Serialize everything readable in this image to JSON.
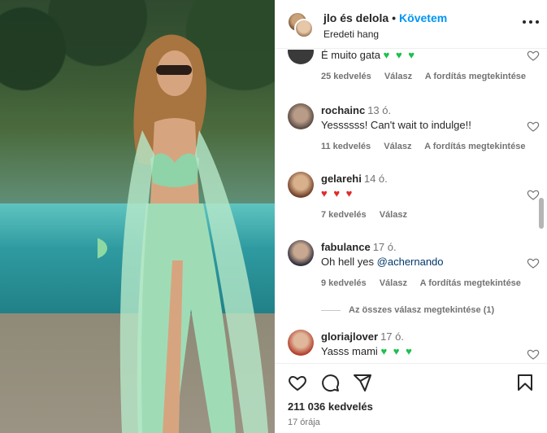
{
  "header": {
    "title": "jlo és delola",
    "follow": "Követem",
    "subtitle": "Eredeti hang"
  },
  "comments": [
    {
      "user": "",
      "time": "",
      "text": "É muito gata",
      "emoji": "♥ ♥ ♥",
      "likes": "25 kedvelés",
      "reply": "Válasz",
      "translate": "A fordítás megtekintése"
    },
    {
      "user": "rochainc",
      "time": "13 ó.",
      "text": "Yessssss! Can't wait to indulge!!",
      "likes": "11 kedvelés",
      "reply": "Válasz",
      "translate": "A fordítás megtekintése"
    },
    {
      "user": "gelarehi",
      "time": "14 ó.",
      "emoji": "♥ ♥ ♥",
      "likes": "7 kedvelés",
      "reply": "Válasz"
    },
    {
      "user": "fabulance",
      "time": "17 ó.",
      "text": "Oh hell yes ",
      "mention": "@achernando",
      "likes": "9 kedvelés",
      "reply": "Válasz",
      "translate": "A fordítás megtekintése",
      "view_replies": "Az összes válasz megtekintése (1)"
    },
    {
      "user": "gloriajlover",
      "time": "17 ó.",
      "text": "Yasss mami",
      "emoji": "♥ ♥ ♥"
    }
  ],
  "footer": {
    "likes": "211 036 kedvelés",
    "time_ago": "17 órája"
  },
  "colors": {
    "accent": "#0095f6",
    "green_heart": "#1dbf4e",
    "red_heart": "#e02b2b",
    "muted": "#737373"
  },
  "icons": [
    "heart-icon",
    "comment-icon",
    "share-icon",
    "bookmark-icon",
    "more-icon"
  ]
}
